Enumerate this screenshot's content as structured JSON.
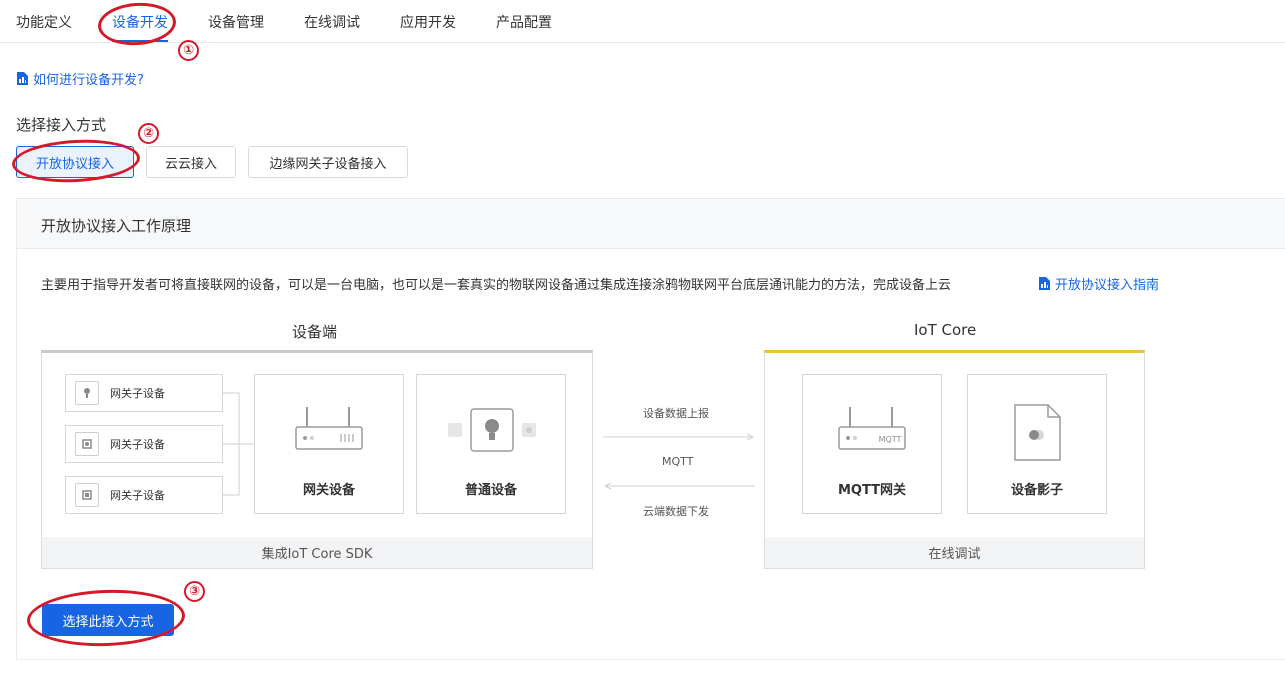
{
  "tabs": [
    {
      "label": "功能定义"
    },
    {
      "label": "设备开发",
      "active": true
    },
    {
      "label": "设备管理"
    },
    {
      "label": "在线调试"
    },
    {
      "label": "应用开发"
    },
    {
      "label": "产品配置"
    }
  ],
  "help_link": "如何进行设备开发?",
  "access": {
    "title": "选择接入方式",
    "methods": [
      "开放协议接入",
      "云云接入",
      "边缘网关子设备接入"
    ],
    "selected": "开放协议接入"
  },
  "card": {
    "title": "开放协议接入工作原理",
    "description": "主要用于指导开发者可将直接联网的设备，可以是一台电脑，也可以是一套真实的物联网设备通过集成连接涂鸦物联网平台底层通讯能力的方法，完成设备上云",
    "guide_link": "开放协议接入指南"
  },
  "diagram": {
    "device_side": {
      "title": "设备端",
      "sub_devices": [
        "网关子设备",
        "网关子设备",
        "网关子设备"
      ],
      "gateway_label": "网关设备",
      "normal_label": "普通设备",
      "footer": "集成IoT Core SDK"
    },
    "flow": {
      "upload": "设备数据上报",
      "protocol": "MQTT",
      "download": "云端数据下发"
    },
    "iot_core": {
      "title": "IoT Core",
      "mqtt_gateway_label": "MQTT网关",
      "shadow_label": "设备影子",
      "router_text": "MQTT",
      "footer": "在线调试"
    }
  },
  "select_button": "选择此接入方式",
  "annotations": {
    "steps": [
      "①",
      "②",
      "③"
    ],
    "color": "#d21a2a"
  },
  "colors": {
    "accent": "#1765e3",
    "iot_border": "#e8c33c"
  }
}
